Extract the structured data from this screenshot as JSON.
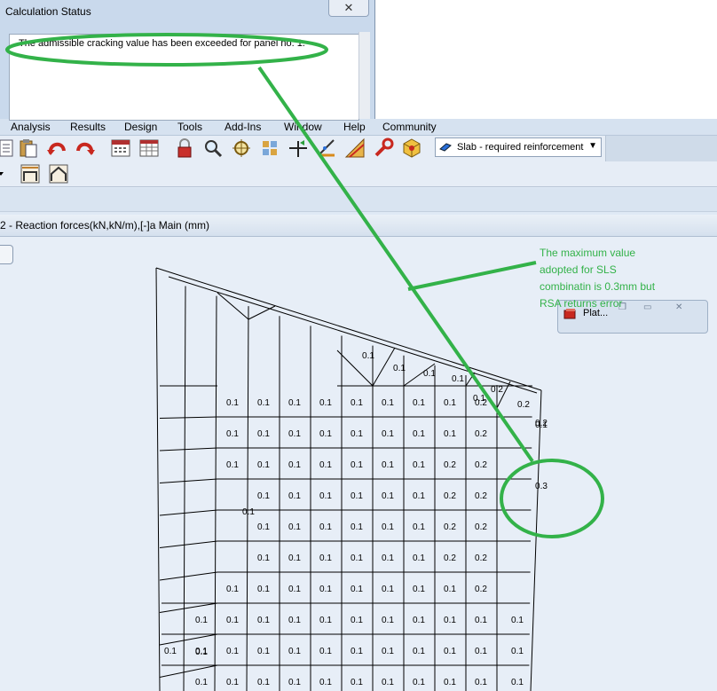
{
  "dialog": {
    "title": "Calculation Status",
    "close_label": "✕",
    "message": "The admissible cracking value has been exceeded for panel no. 1."
  },
  "menu": [
    "Analysis",
    "Results",
    "Design",
    "Tools",
    "Add-Ins",
    "Window",
    "Help",
    "Community"
  ],
  "toolbar": {
    "icons": [
      "document-icon",
      "paste-icon",
      "undo-icon",
      "redo-icon",
      "calculator-icon",
      "table-icon",
      "lock-icon",
      "zoom-icon",
      "zoom-window-icon",
      "structure-icon",
      "supports-icon",
      "ruler-icon",
      "chart-icon",
      "wrench-icon",
      "cube-icon"
    ],
    "case_select_value": "Slab - required reinforcement"
  },
  "view_title": "2 - Reaction forces(kN,kN/m),[-]a Main (mm)",
  "palette": {
    "label": "Plat..."
  },
  "annotation": {
    "lines": [
      "The maximum value",
      "adopted for SLS",
      "combinatin is 0.3mm but",
      "RSA returns error"
    ],
    "color": "#33b249"
  },
  "results": {
    "column_labels": [
      [
        "0.1",
        "0.1",
        "0.1",
        "0.1",
        "0.1",
        "0.1",
        "0.1",
        "0.1",
        "0.2"
      ],
      [
        "0.1",
        "0.1",
        "0.1",
        "0.1",
        "0.1",
        "0.1",
        "0.1",
        "0.1",
        "0.2"
      ],
      [
        "0.1",
        "0.1",
        "0.1",
        "0.1",
        "0.1",
        "0.1",
        "0.1",
        "0.2",
        "0.2"
      ],
      [
        "0.1",
        "0.1",
        "0.1",
        "0.1",
        "0.1",
        "0.1",
        "0.2",
        "0.2"
      ],
      [
        "0.1",
        "0.1",
        "0.1",
        "0.1",
        "0.1",
        "0.1",
        "0.2",
        "0.2"
      ],
      [
        "0.1",
        "0.1",
        "0.1",
        "0.1",
        "0.1",
        "0.1",
        "0.2",
        "0.2"
      ],
      [
        "0.1",
        "0.1",
        "0.1",
        "0.1",
        "0.1",
        "0.1",
        "0.1",
        "0.1",
        "0.2"
      ],
      [
        "0.1",
        "0.1",
        "0.1",
        "0.1",
        "0.1",
        "0.1",
        "0.1",
        "0.1",
        "0.1",
        "0.1",
        "0.1"
      ],
      [
        "0.1",
        "0.1",
        "0.1",
        "0.1",
        "0.1",
        "0.1",
        "0.1",
        "0.1",
        "0.1",
        "0.1",
        "0.1",
        "0.1"
      ],
      [
        "0.1",
        "0.1",
        "0.1",
        "0.1",
        "0.1",
        "0.1",
        "0.1",
        "0.1",
        "0.1",
        "0.1",
        "0.1"
      ]
    ],
    "top_edge_labels": [
      "0.1",
      "0.1",
      "0.1",
      "0.1",
      "0.1",
      "0.2",
      "0.2",
      "0.2"
    ],
    "large_labels": [
      "0.1",
      "0.3",
      "0.1",
      "0.1"
    ]
  }
}
